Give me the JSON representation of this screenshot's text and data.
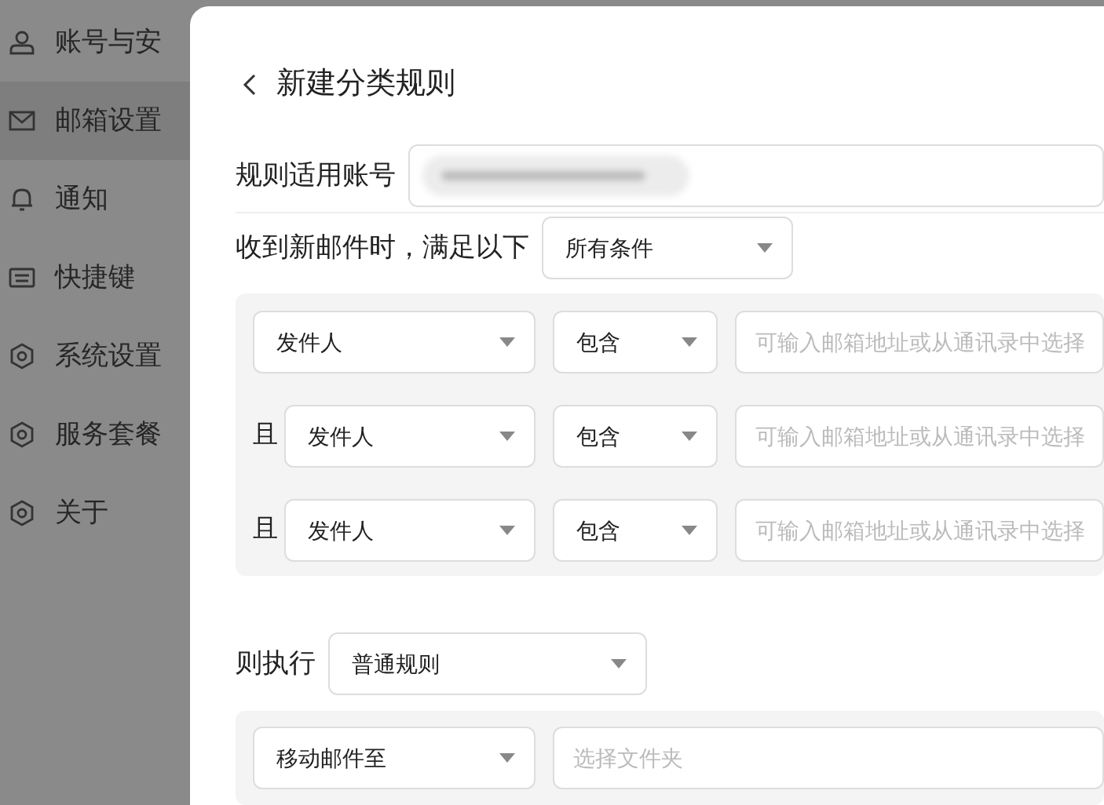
{
  "sidebar": {
    "items": [
      {
        "kind": "user",
        "label": "账号与安",
        "selected": false
      },
      {
        "kind": "mail",
        "label": "邮箱设置",
        "selected": true
      },
      {
        "kind": "bell",
        "label": "通知",
        "selected": false
      },
      {
        "kind": "keyboard",
        "label": "快捷键",
        "selected": false
      },
      {
        "kind": "hex",
        "label": "系统设置",
        "selected": false
      },
      {
        "kind": "hex",
        "label": "服务套餐",
        "selected": false
      },
      {
        "kind": "hex",
        "label": "关于",
        "selected": false
      }
    ]
  },
  "dialog": {
    "title": "新建分类规则",
    "account_label": "规则适用账号",
    "condition_label": "收到新邮件时，满足以下",
    "match": "所有条件",
    "conditions": [
      {
        "field": "发件人",
        "operator": "包含",
        "placeholder": "可输入邮箱地址或从通讯录中选择"
      },
      {
        "connector": "且",
        "field": "发件人",
        "operator": "包含",
        "placeholder": "可输入邮箱地址或从通讯录中选择"
      },
      {
        "connector": "且",
        "field": "发件人",
        "operator": "包含",
        "placeholder": "可输入邮箱地址或从通讯录中选择"
      }
    ],
    "action_label": "则执行",
    "rule_type": "普通规则",
    "actions": [
      {
        "action": "移动邮件至",
        "placeholder": "选择文件夹"
      }
    ]
  }
}
